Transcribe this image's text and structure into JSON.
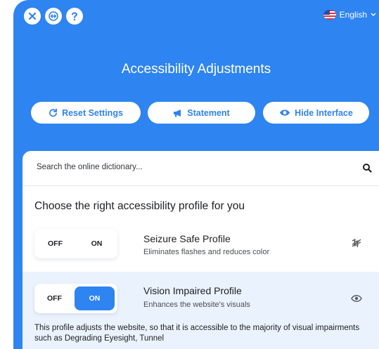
{
  "topbar": {
    "language": "English",
    "icons": [
      "close-icon",
      "swap-icon",
      "help-icon",
      "us-flag-icon",
      "chevron-down-icon"
    ]
  },
  "header": {
    "title": "Accessibility Adjustments"
  },
  "actions": {
    "reset_label": "Reset Settings",
    "statement_label": "Statement",
    "hide_label": "Hide Interface"
  },
  "search": {
    "placeholder": "Search the online dictionary..."
  },
  "profiles_heading": "Choose the right accessibility profile for you",
  "profiles": [
    {
      "off_label": "OFF",
      "on_label": "ON",
      "title": "Seizure Safe Profile",
      "description": "Eliminates flashes and reduces color",
      "icon": "seizure-icon",
      "state": "off"
    },
    {
      "off_label": "OFF",
      "on_label": "ON",
      "title": "Vision Impaired Profile",
      "description": "Enhances the website's visuals",
      "icon": "eye-icon",
      "state": "on",
      "details": "This profile adjusts the website, so that it is accessible to the majority of visual impairments such as Degrading Eyesight, Tunnel"
    }
  ],
  "colors": {
    "primary": "#2e84f0",
    "panel_bg": "#ffffff",
    "active_row_bg": "#eaf3fd"
  }
}
